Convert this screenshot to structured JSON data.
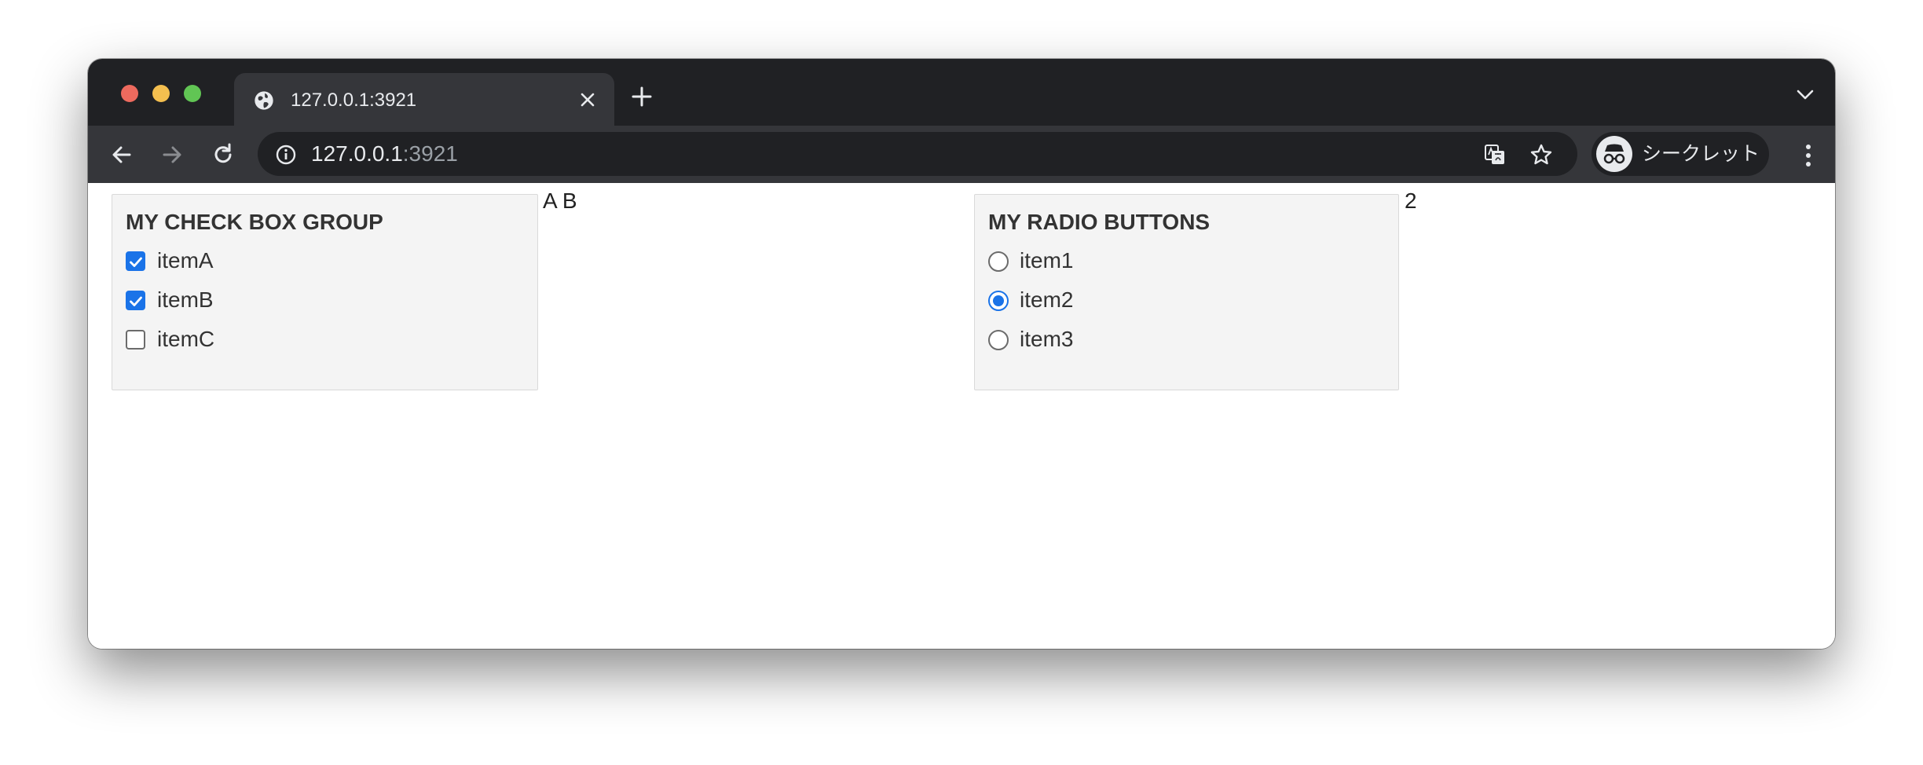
{
  "browser": {
    "tab_title": "127.0.0.1:3921",
    "url_host": "127.0.0.1",
    "url_port": ":3921",
    "profile_label": "シークレット",
    "icons": {
      "tab": "globe-icon",
      "close": "close-icon",
      "new_tab": "plus-icon",
      "tab_menu": "chevron-down-icon",
      "back": "arrow-left-icon",
      "forward": "arrow-right-icon",
      "reload": "reload-icon",
      "site_info": "info-icon",
      "translate": "translate-icon",
      "bookmark": "star-icon",
      "profile": "incognito-icon",
      "menu": "kebab-menu-icon"
    }
  },
  "checkbox_group": {
    "title": "MY CHECK BOX GROUP",
    "items": [
      {
        "label": "itemA",
        "checked": true
      },
      {
        "label": "itemB",
        "checked": true
      },
      {
        "label": "itemC",
        "checked": false
      }
    ],
    "output": "A B"
  },
  "radio_group": {
    "title": "MY RADIO BUTTONS",
    "items": [
      {
        "label": "item1",
        "checked": false
      },
      {
        "label": "item2",
        "checked": true
      },
      {
        "label": "item3",
        "checked": false
      }
    ],
    "output": "2"
  },
  "colors": {
    "accent": "#1a73e8",
    "tabstrip": "#202124",
    "toolbar": "#35363a",
    "panel_bg": "#f4f4f4"
  }
}
